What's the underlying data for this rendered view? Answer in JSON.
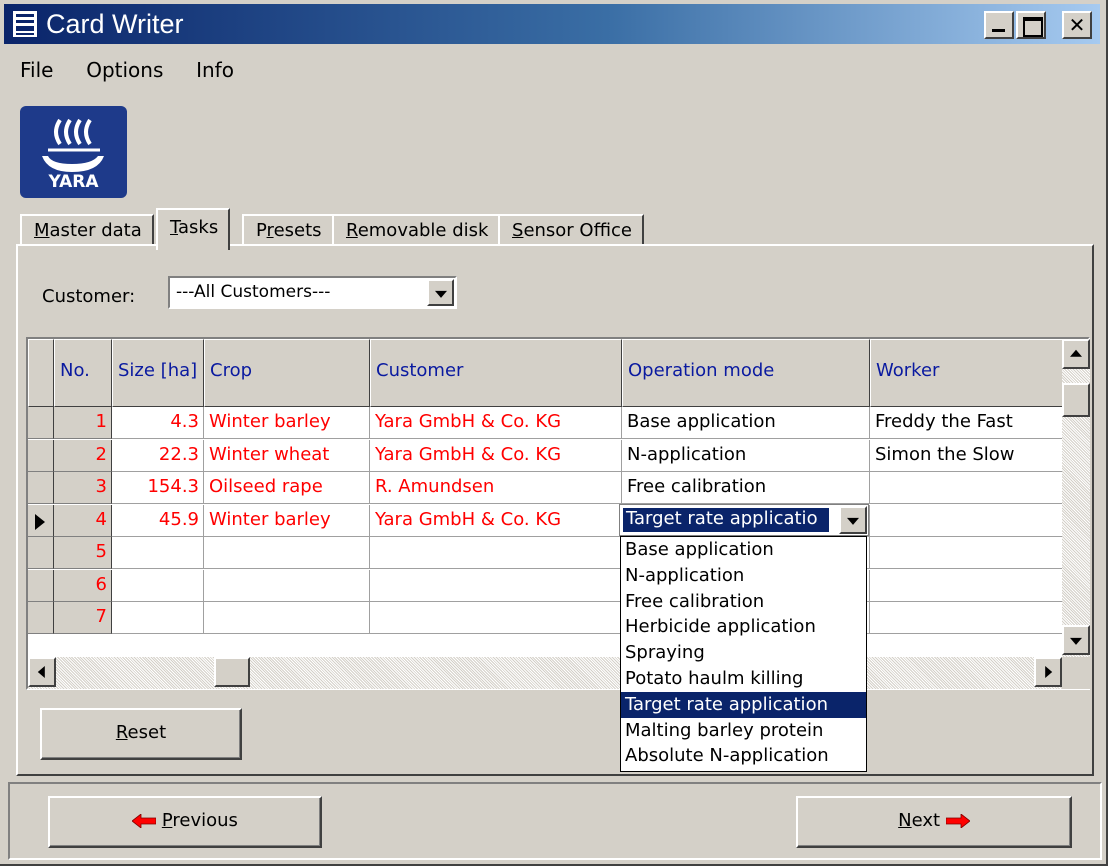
{
  "window": {
    "title": "Card Writer"
  },
  "menu": [
    "File",
    "Options",
    "Info"
  ],
  "logo": {
    "text": "YARA"
  },
  "tabs": [
    {
      "label_pre": "",
      "mnemonic": "M",
      "label_post": "aster data",
      "active": false
    },
    {
      "label_pre": "",
      "mnemonic": "T",
      "label_post": "asks",
      "active": true
    },
    {
      "label_pre": "P",
      "mnemonic": "r",
      "label_post": "esets",
      "active": false
    },
    {
      "label_pre": "",
      "mnemonic": "R",
      "label_post": "emovable disk",
      "active": false
    },
    {
      "label_pre": "",
      "mnemonic": "S",
      "label_post": "ensor Office",
      "active": false
    }
  ],
  "customer_filter": {
    "label": "Customer:",
    "value": "---All Customers---"
  },
  "grid": {
    "columns": [
      "No.",
      "Size [ha]",
      "Crop",
      "Customer",
      "Operation mode",
      "Worker"
    ],
    "rows": [
      {
        "no": "1",
        "size": "4.3",
        "crop": "Winter barley",
        "customer": "Yara GmbH & Co. KG",
        "mode": "Base application",
        "worker": "Freddy the Fast"
      },
      {
        "no": "2",
        "size": "22.3",
        "crop": "Winter wheat",
        "customer": "Yara GmbH & Co. KG",
        "mode": "N-application",
        "worker": "Simon the Slow"
      },
      {
        "no": "3",
        "size": "154.3",
        "crop": "Oilseed rape",
        "customer": "R. Amundsen",
        "mode": "Free calibration",
        "worker": ""
      },
      {
        "no": "4",
        "size": "45.9",
        "crop": "Winter barley",
        "customer": "Yara GmbH & Co. KG",
        "mode": "",
        "worker": ""
      },
      {
        "no": "5",
        "size": "",
        "crop": "",
        "customer": "",
        "mode": "",
        "worker": ""
      },
      {
        "no": "6",
        "size": "",
        "crop": "",
        "customer": "",
        "mode": "",
        "worker": ""
      },
      {
        "no": "7",
        "size": "",
        "crop": "",
        "customer": "",
        "mode": "",
        "worker": ""
      }
    ],
    "current_row": 4
  },
  "operation_editor": {
    "value": "Target rate applicatio",
    "options": [
      "Base application",
      "N-application",
      "Free calibration",
      "Herbicide application",
      "Spraying",
      "Potato haulm killing",
      "Target rate application",
      "Malting barley protein",
      "Absolute N-application"
    ],
    "selected_index": 6
  },
  "buttons": {
    "reset": {
      "mnemonic": "R",
      "rest": "eset"
    },
    "previous": {
      "mnemonic": "P",
      "rest": "revious"
    },
    "next": {
      "mnemonic": "N",
      "rest": "ext"
    }
  },
  "colors": {
    "title_start": "#0a246a",
    "title_end": "#a6caf0",
    "face": "#d4d0c8",
    "data_red": "#ff0000",
    "header_blue": "#0a1aa0",
    "logo_blue": "#1e3a8a"
  },
  "icons": {
    "app": "yara-viking-ship-icon",
    "previous": "red-arrow-left-icon",
    "next": "red-arrow-right-icon"
  }
}
